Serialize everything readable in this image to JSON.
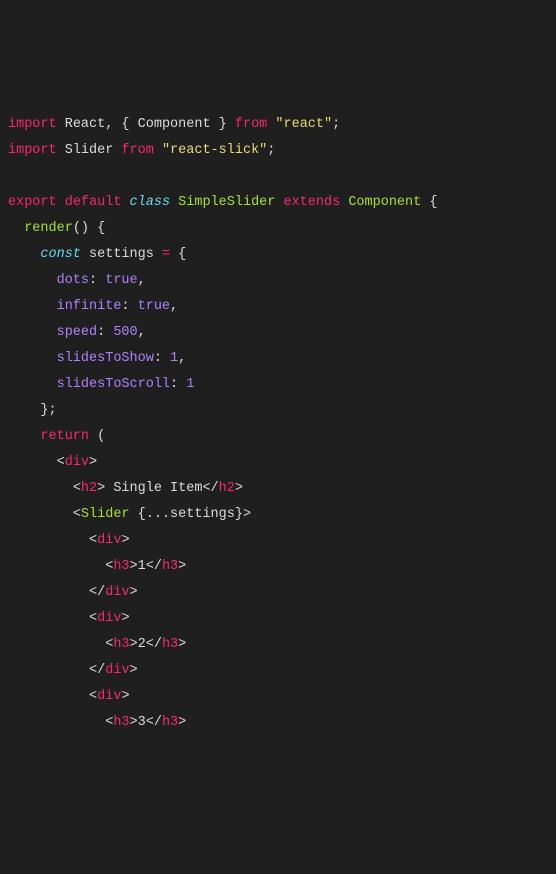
{
  "code": {
    "l1_import": "import",
    "l1_react": "React",
    "l1_comma": ", { ",
    "l1_component": "Component",
    "l1_brace": " } ",
    "l1_from": "from",
    "l1_str": "\"react\"",
    "l1_semi": ";",
    "l2_import": "import",
    "l2_slider": "Slider",
    "l2_from": "from",
    "l2_str": "\"react-slick\"",
    "l2_semi": ";",
    "l4_export": "export",
    "l4_default": "default",
    "l4_class": "class",
    "l4_name": "SimpleSlider",
    "l4_extends": "extends",
    "l4_component": "Component",
    "l4_brace": " {",
    "l5_render": "render",
    "l5_paren": "() {",
    "l6_const": "const",
    "l6_settings": " settings ",
    "l6_eq": "=",
    "l6_brace": " {",
    "l7_key": "dots",
    "l7_colon": ": ",
    "l7_val": "true",
    "l7_comma": ",",
    "l8_key": "infinite",
    "l8_colon": ": ",
    "l8_val": "true",
    "l8_comma": ",",
    "l9_key": "speed",
    "l9_colon": ": ",
    "l9_val": "500",
    "l9_comma": ",",
    "l10_key": "slidesToShow",
    "l10_colon": ": ",
    "l10_val": "1",
    "l10_comma": ",",
    "l11_key": "slidesToScroll",
    "l11_colon": ": ",
    "l11_val": "1",
    "l12_close": "};",
    "l13_return": "return",
    "l13_paren": " (",
    "l14_div_open": "<",
    "l14_div": "div",
    "l14_div_close": ">",
    "l15_h2_open": "<",
    "l15_h2": "h2",
    "l15_h2_gt": ">",
    "l15_text": " Single Item",
    "l15_h2_close_open": "</",
    "l15_h2_close": "h2",
    "l15_h2_close_gt": ">",
    "l16_slider_open": "<",
    "l16_slider": "Slider",
    "l16_spread": " {...settings}",
    "l16_slider_close": ">",
    "l17_div_open": "<",
    "l17_div": "div",
    "l17_div_close": ">",
    "l18_h3_open": "<",
    "l18_h3": "h3",
    "l18_h3_gt": ">",
    "l18_text": "1",
    "l18_h3_close_open": "</",
    "l18_h3_close": "h3",
    "l18_h3_close_gt": ">",
    "l19_div_close_open": "</",
    "l19_div": "div",
    "l19_div_close": ">",
    "l20_div_open": "<",
    "l20_div": "div",
    "l20_div_close": ">",
    "l21_h3_open": "<",
    "l21_h3": "h3",
    "l21_h3_gt": ">",
    "l21_text": "2",
    "l21_h3_close_open": "</",
    "l21_h3_close": "h3",
    "l21_h3_close_gt": ">",
    "l22_div_close_open": "</",
    "l22_div": "div",
    "l22_div_close": ">",
    "l23_div_open": "<",
    "l23_div": "div",
    "l23_div_close": ">",
    "l24_h3_open": "<",
    "l24_h3": "h3",
    "l24_h3_gt": ">",
    "l24_text": "3",
    "l24_h3_close_open": "</",
    "l24_h3_close": "h3",
    "l24_h3_close_gt": ">"
  }
}
